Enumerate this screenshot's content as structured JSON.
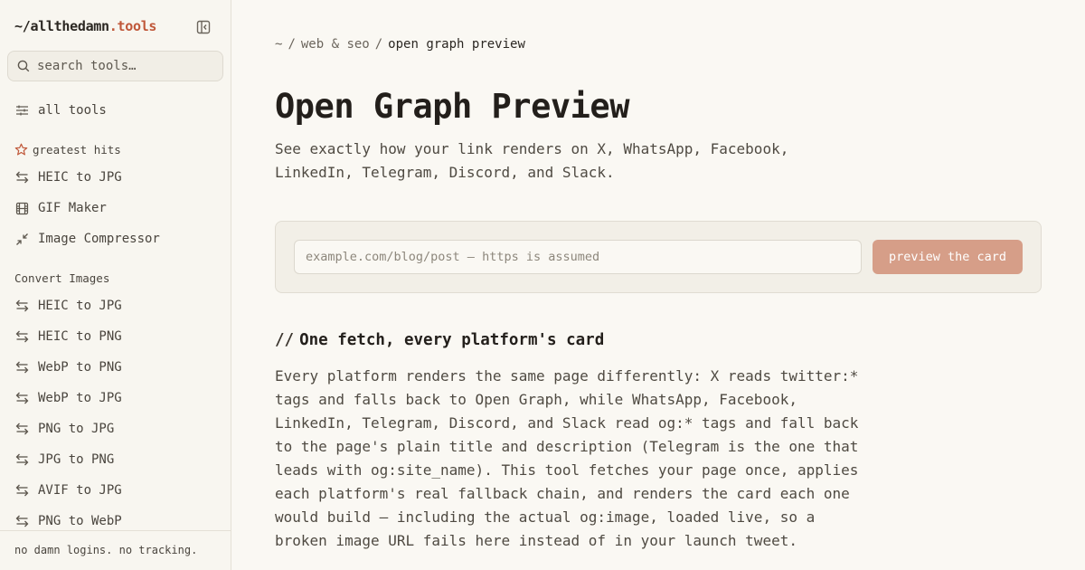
{
  "sidebar": {
    "brand_prefix": "~/allthedamn",
    "brand_accent": ".tools",
    "search_placeholder": "search tools…",
    "all_tools": "all tools",
    "greatest_hits_label": "greatest hits",
    "greatest_hits": [
      {
        "label": "HEIC to JPG",
        "icon": "convert-arrows-icon"
      },
      {
        "label": "GIF Maker",
        "icon": "film-icon"
      },
      {
        "label": "Image Compressor",
        "icon": "compress-arrows-icon"
      }
    ],
    "convert_images_label": "Convert Images",
    "convert_images": [
      {
        "label": "HEIC to JPG"
      },
      {
        "label": "HEIC to PNG"
      },
      {
        "label": "WebP to PNG"
      },
      {
        "label": "WebP to JPG"
      },
      {
        "label": "PNG to JPG"
      },
      {
        "label": "JPG to PNG"
      },
      {
        "label": "AVIF to JPG"
      },
      {
        "label": "PNG to WebP"
      }
    ],
    "footer": "no damn logins. no tracking."
  },
  "breadcrumb": {
    "root": "~",
    "category": "web & seo",
    "current": "open graph preview"
  },
  "page": {
    "title": "Open Graph Preview",
    "subtitle": "See exactly how your link renders on X, WhatsApp, Facebook, LinkedIn, Telegram, Discord, and Slack."
  },
  "form": {
    "url_placeholder": "example.com/blog/post — https is assumed",
    "submit_label": "preview the card"
  },
  "section": {
    "heading_prefix": "//",
    "heading": "One fetch, every platform's card",
    "body": "Every platform renders the same page differently: X reads twitter:* tags and falls back to Open Graph, while WhatsApp, Facebook, LinkedIn, Telegram, Discord, and Slack read og:* tags and fall back to the page's plain title and description (Telegram is the one that leads with og:site_name). This tool fetches your page once, applies each platform's real fallback chain, and renders the card each one would build — including the actual og:image, loaded live, so a broken image URL fails here instead of in your launch tweet."
  },
  "colors": {
    "accent": "#c0583a",
    "button": "#d69e88",
    "background": "#faf8f3"
  }
}
